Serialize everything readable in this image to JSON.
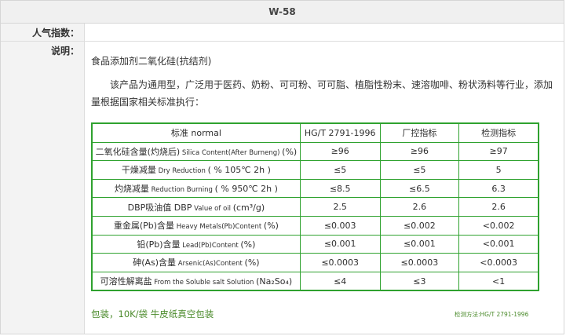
{
  "product": {
    "title": "W-58"
  },
  "fields": {
    "popularity_label": "人气指数：",
    "description_label": "说明："
  },
  "description": {
    "name": "食品添加剂二氧化硅(抗结剂)",
    "paragraph": "该产品为通用型，广泛用于医药、奶粉、可可粉、可可脂、植脂性粉末、速溶咖啡、粉状汤料等行业，添加量根据国家相关标准执行："
  },
  "spec_table": {
    "headers": [
      "标准 normal",
      "HG/T 2791-1996",
      "厂控指标",
      "检测指标"
    ],
    "rows": [
      {
        "name_cn": "二氧化硅含量(灼烧后)",
        "name_en": " Silica Content(After Burneng) ",
        "unit": "(%)",
        "values": [
          "≥96",
          "≥96",
          "≥97"
        ]
      },
      {
        "name_cn": "干燥减量",
        "name_en": " Dry Reduction ",
        "unit": "( % 105℃ 2h )",
        "values": [
          "≤5",
          "≤5",
          "5"
        ]
      },
      {
        "name_cn": "灼烧减量",
        "name_en": " Reduction Burning ",
        "unit": "( % 950℃ 2h )",
        "values": [
          "≤8.5",
          "≤6.5",
          "6.3"
        ]
      },
      {
        "name_cn": "DBP吸油值 DBP",
        "name_en": " Value of oil ",
        "unit": "(cm³/g)",
        "values": [
          "2.5",
          "2.6",
          "2.6"
        ]
      },
      {
        "name_cn": "重金属(Pb)含量",
        "name_en": " Heavy Metals(Pb)Content ",
        "unit": "(%)",
        "values": [
          "≤0.003",
          "≤0.002",
          "<0.002"
        ]
      },
      {
        "name_cn": "铅(Pb)含量",
        "name_en": " Lead(Pb)Content ",
        "unit": "(%)",
        "values": [
          "≤0.001",
          "≤0.001",
          "<0.001"
        ]
      },
      {
        "name_cn": "砷(As)含量",
        "name_en": " Arsenic(As)Content ",
        "unit": "(%)",
        "values": [
          "≤0.0003",
          "≤0.0003",
          "<0.0003"
        ]
      },
      {
        "name_cn": "可溶性解离盐",
        "name_en": " From the Soluble salt Solution ",
        "unit": "(Na₂So₄)",
        "values": [
          "≤4",
          "≤3",
          "<1"
        ]
      }
    ]
  },
  "footer": {
    "packaging": "包装，10K/袋 牛皮纸真空包装",
    "test_method": "检测方法:HG/T 2791-1996"
  },
  "colors": {
    "table_border": "#2fa22f",
    "footer_text": "#4a8a2a",
    "header_bg": "#f0f0f0",
    "label_bg": "#f3f3f3"
  }
}
